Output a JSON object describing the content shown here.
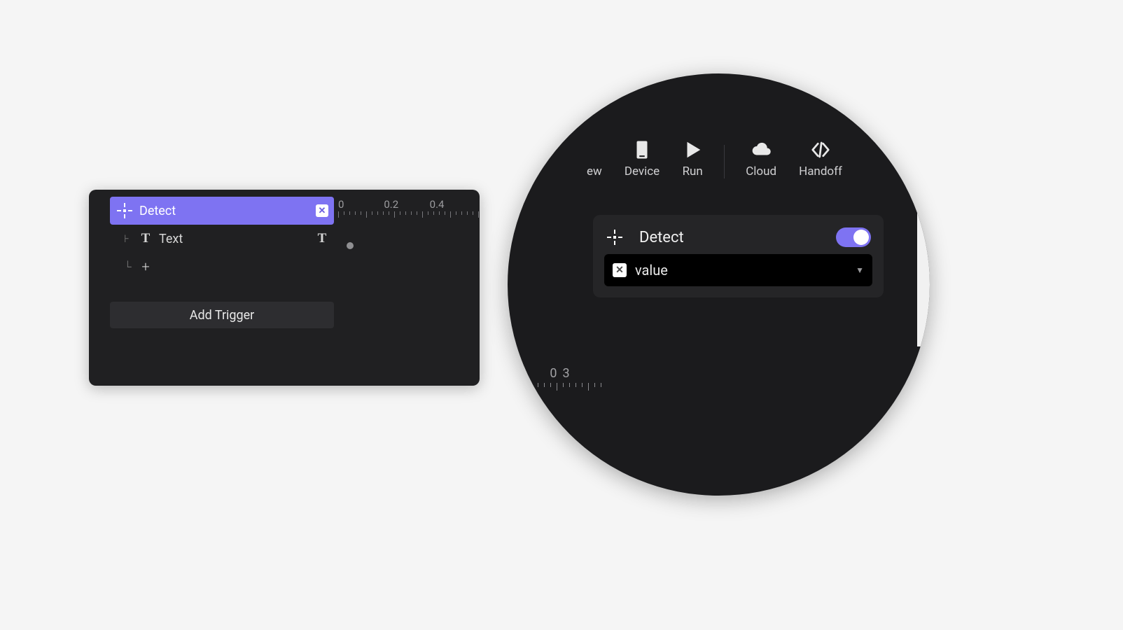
{
  "left_panel": {
    "detect_label": "Detect",
    "rows": {
      "text": {
        "label": "Text"
      },
      "add": {
        "label": "+"
      }
    },
    "add_trigger_label": "Add Trigger",
    "ruler": [
      "0",
      "0.2",
      "0.4"
    ]
  },
  "right_panel": {
    "toolbar": {
      "preview_fragment": "ew",
      "device": "Device",
      "run": "Run",
      "cloud": "Cloud",
      "handoff": "Handoff"
    },
    "card": {
      "title": "Detect",
      "value_label": "value",
      "toggle_on": true
    },
    "mini_ruler": [
      "0",
      "3"
    ]
  }
}
